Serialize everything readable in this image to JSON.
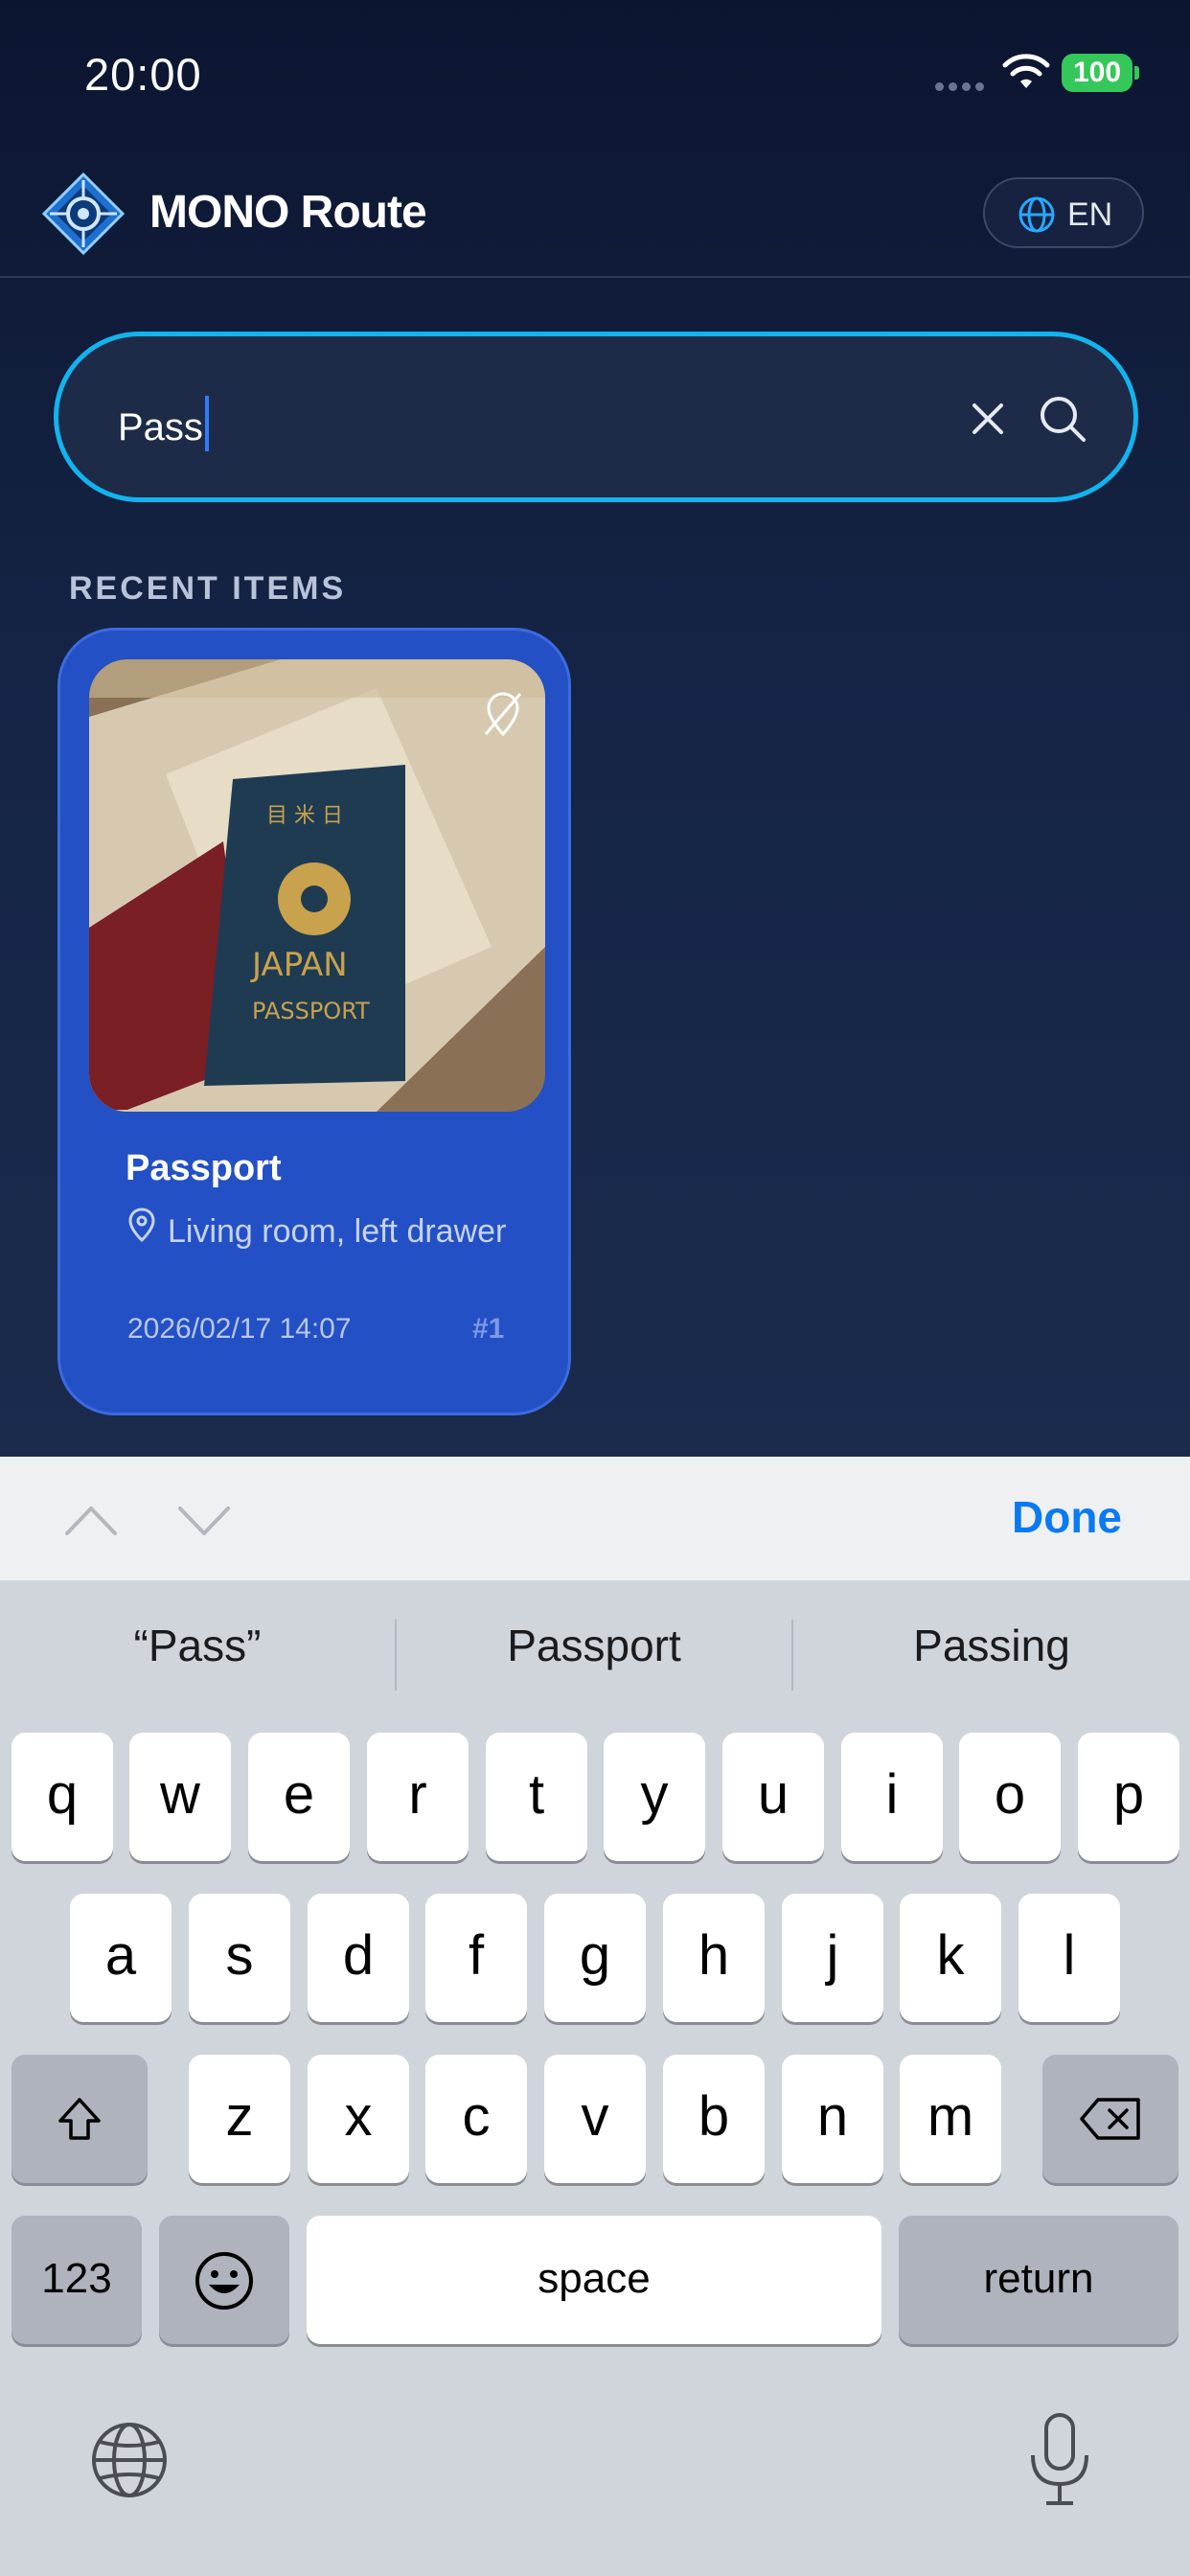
{
  "status_bar": {
    "time": "20:00",
    "battery": "100"
  },
  "header": {
    "app_title": "MONO Route",
    "language_label": "EN"
  },
  "search": {
    "value": "Pass"
  },
  "recent": {
    "section_title": "RECENT ITEMS",
    "items": [
      {
        "name": "Passport",
        "location": "Living room, left drawer",
        "date": "2026/02/17 14:07",
        "index": "#1"
      }
    ]
  },
  "keyboard_accessory": {
    "done_label": "Done"
  },
  "keyboard": {
    "suggestions": [
      "“Pass”",
      "Passport",
      "Passing"
    ],
    "row1": [
      "q",
      "w",
      "e",
      "r",
      "t",
      "y",
      "u",
      "i",
      "o",
      "p"
    ],
    "row2": [
      "a",
      "s",
      "d",
      "f",
      "g",
      "h",
      "j",
      "k",
      "l"
    ],
    "row3": [
      "z",
      "x",
      "c",
      "v",
      "b",
      "n",
      "m"
    ],
    "numbers_label": "123",
    "space_label": "space",
    "return_label": "return"
  },
  "colors": {
    "accent": "#12b4ee",
    "card": "#2350c4",
    "done": "#0a7af3",
    "battery": "#34c759"
  }
}
